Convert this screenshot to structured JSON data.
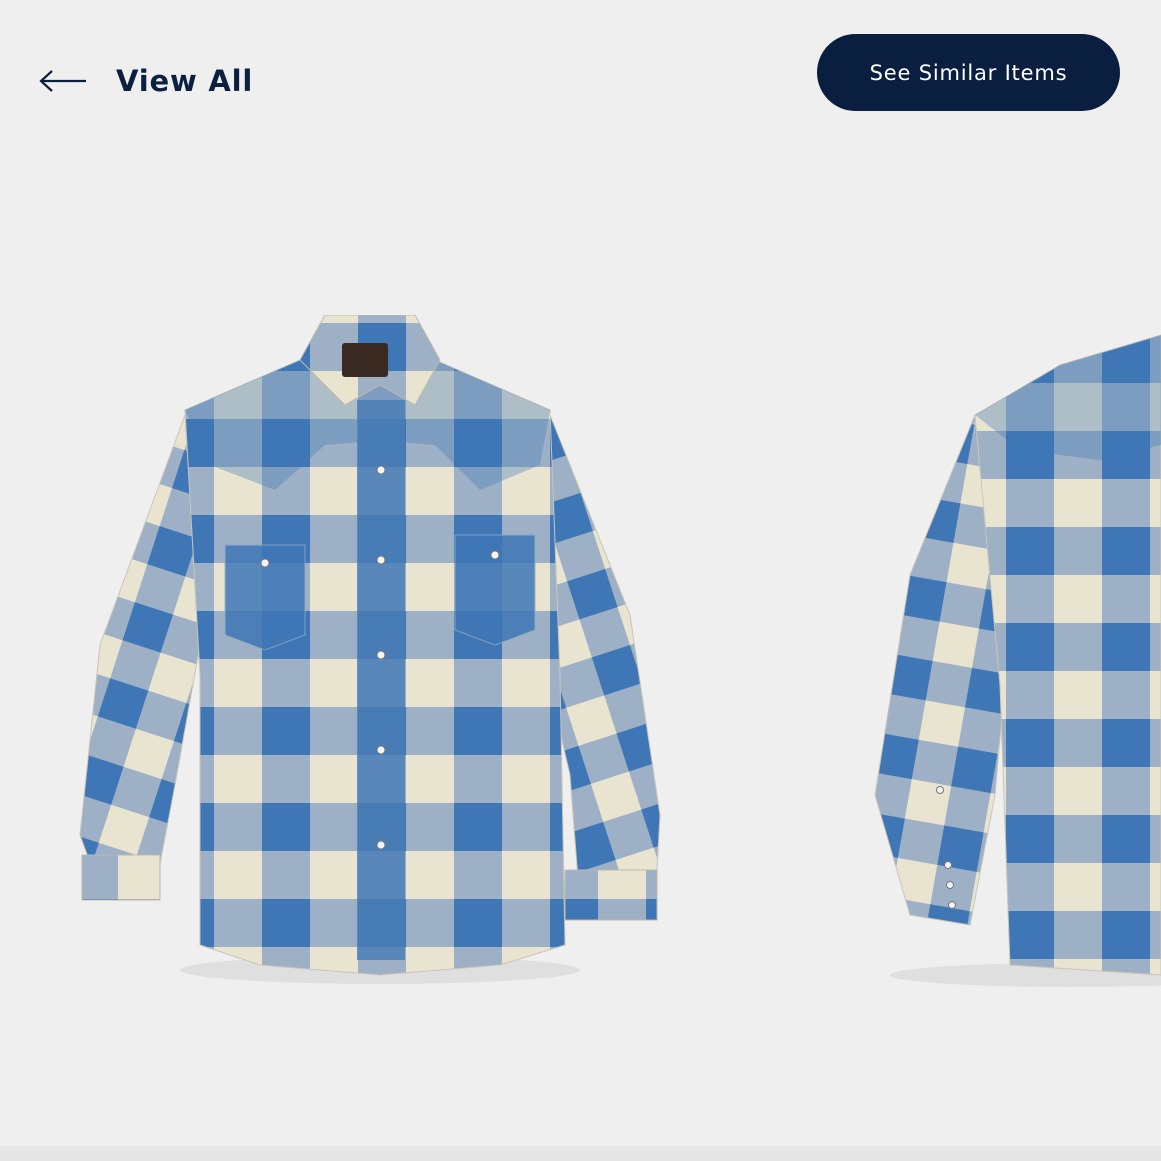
{
  "header": {
    "back_label": "View All",
    "back_icon": "arrow-left-icon",
    "similar_label": "See Similar Items"
  },
  "colors": {
    "background": "#efefef",
    "navy": "#0a1f3f",
    "plaid_blue": "#3f77b6",
    "plaid_cream": "#e9e4d0",
    "plaid_mid": "#93aac6"
  },
  "carousel": {
    "items": [
      {
        "view": "front",
        "image": "blue-cream-buffalo-check-western-shirt-front"
      },
      {
        "view": "back",
        "image": "blue-cream-buffalo-check-western-shirt-back"
      }
    ]
  }
}
